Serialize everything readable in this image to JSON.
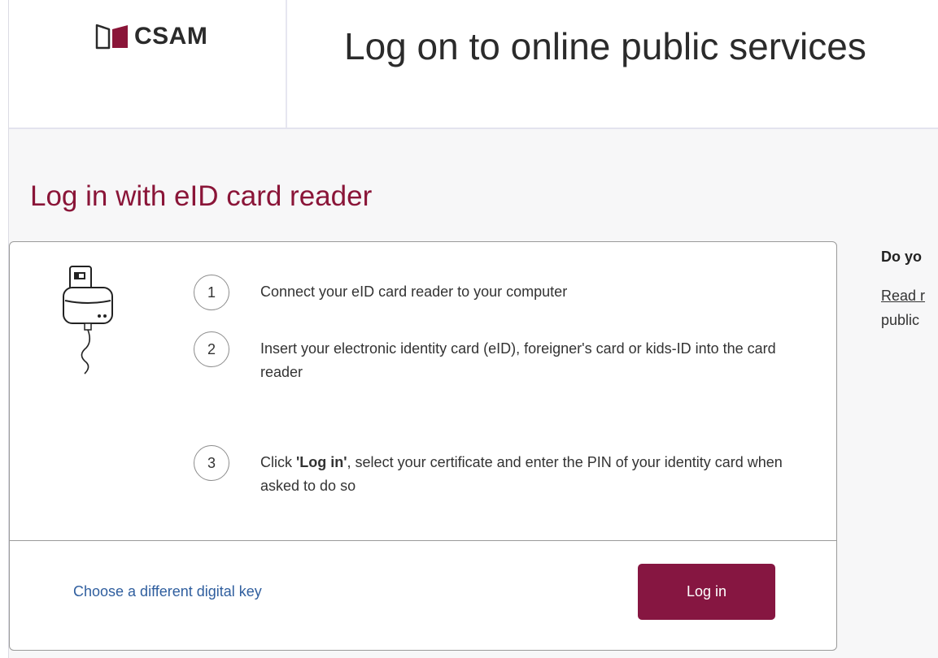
{
  "header": {
    "logo_text": "CSAM",
    "title": "Log on to online public services"
  },
  "section": {
    "title": "Log in with eID card reader"
  },
  "steps": [
    {
      "number": "1",
      "text": "Connect your eID card reader to your computer"
    },
    {
      "number": "2",
      "text": "Insert your electronic identity card (eID), foreigner's card or kids-ID into the card reader"
    },
    {
      "number": "3",
      "text_before": "Click ",
      "text_bold": "'Log in'",
      "text_after": ", select your certificate and enter the PIN of your identity card when asked to do so"
    }
  ],
  "footer": {
    "alt_link": "Choose a different digital key",
    "login_button": "Log in"
  },
  "aside": {
    "heading": "Do yo",
    "link_text": "Read r",
    "line2": "public"
  },
  "colors": {
    "accent": "#861641",
    "section_title": "#8a1538",
    "link": "#2f5e9e"
  },
  "icons": [
    "csam-logo-icon",
    "card-reader-icon"
  ]
}
